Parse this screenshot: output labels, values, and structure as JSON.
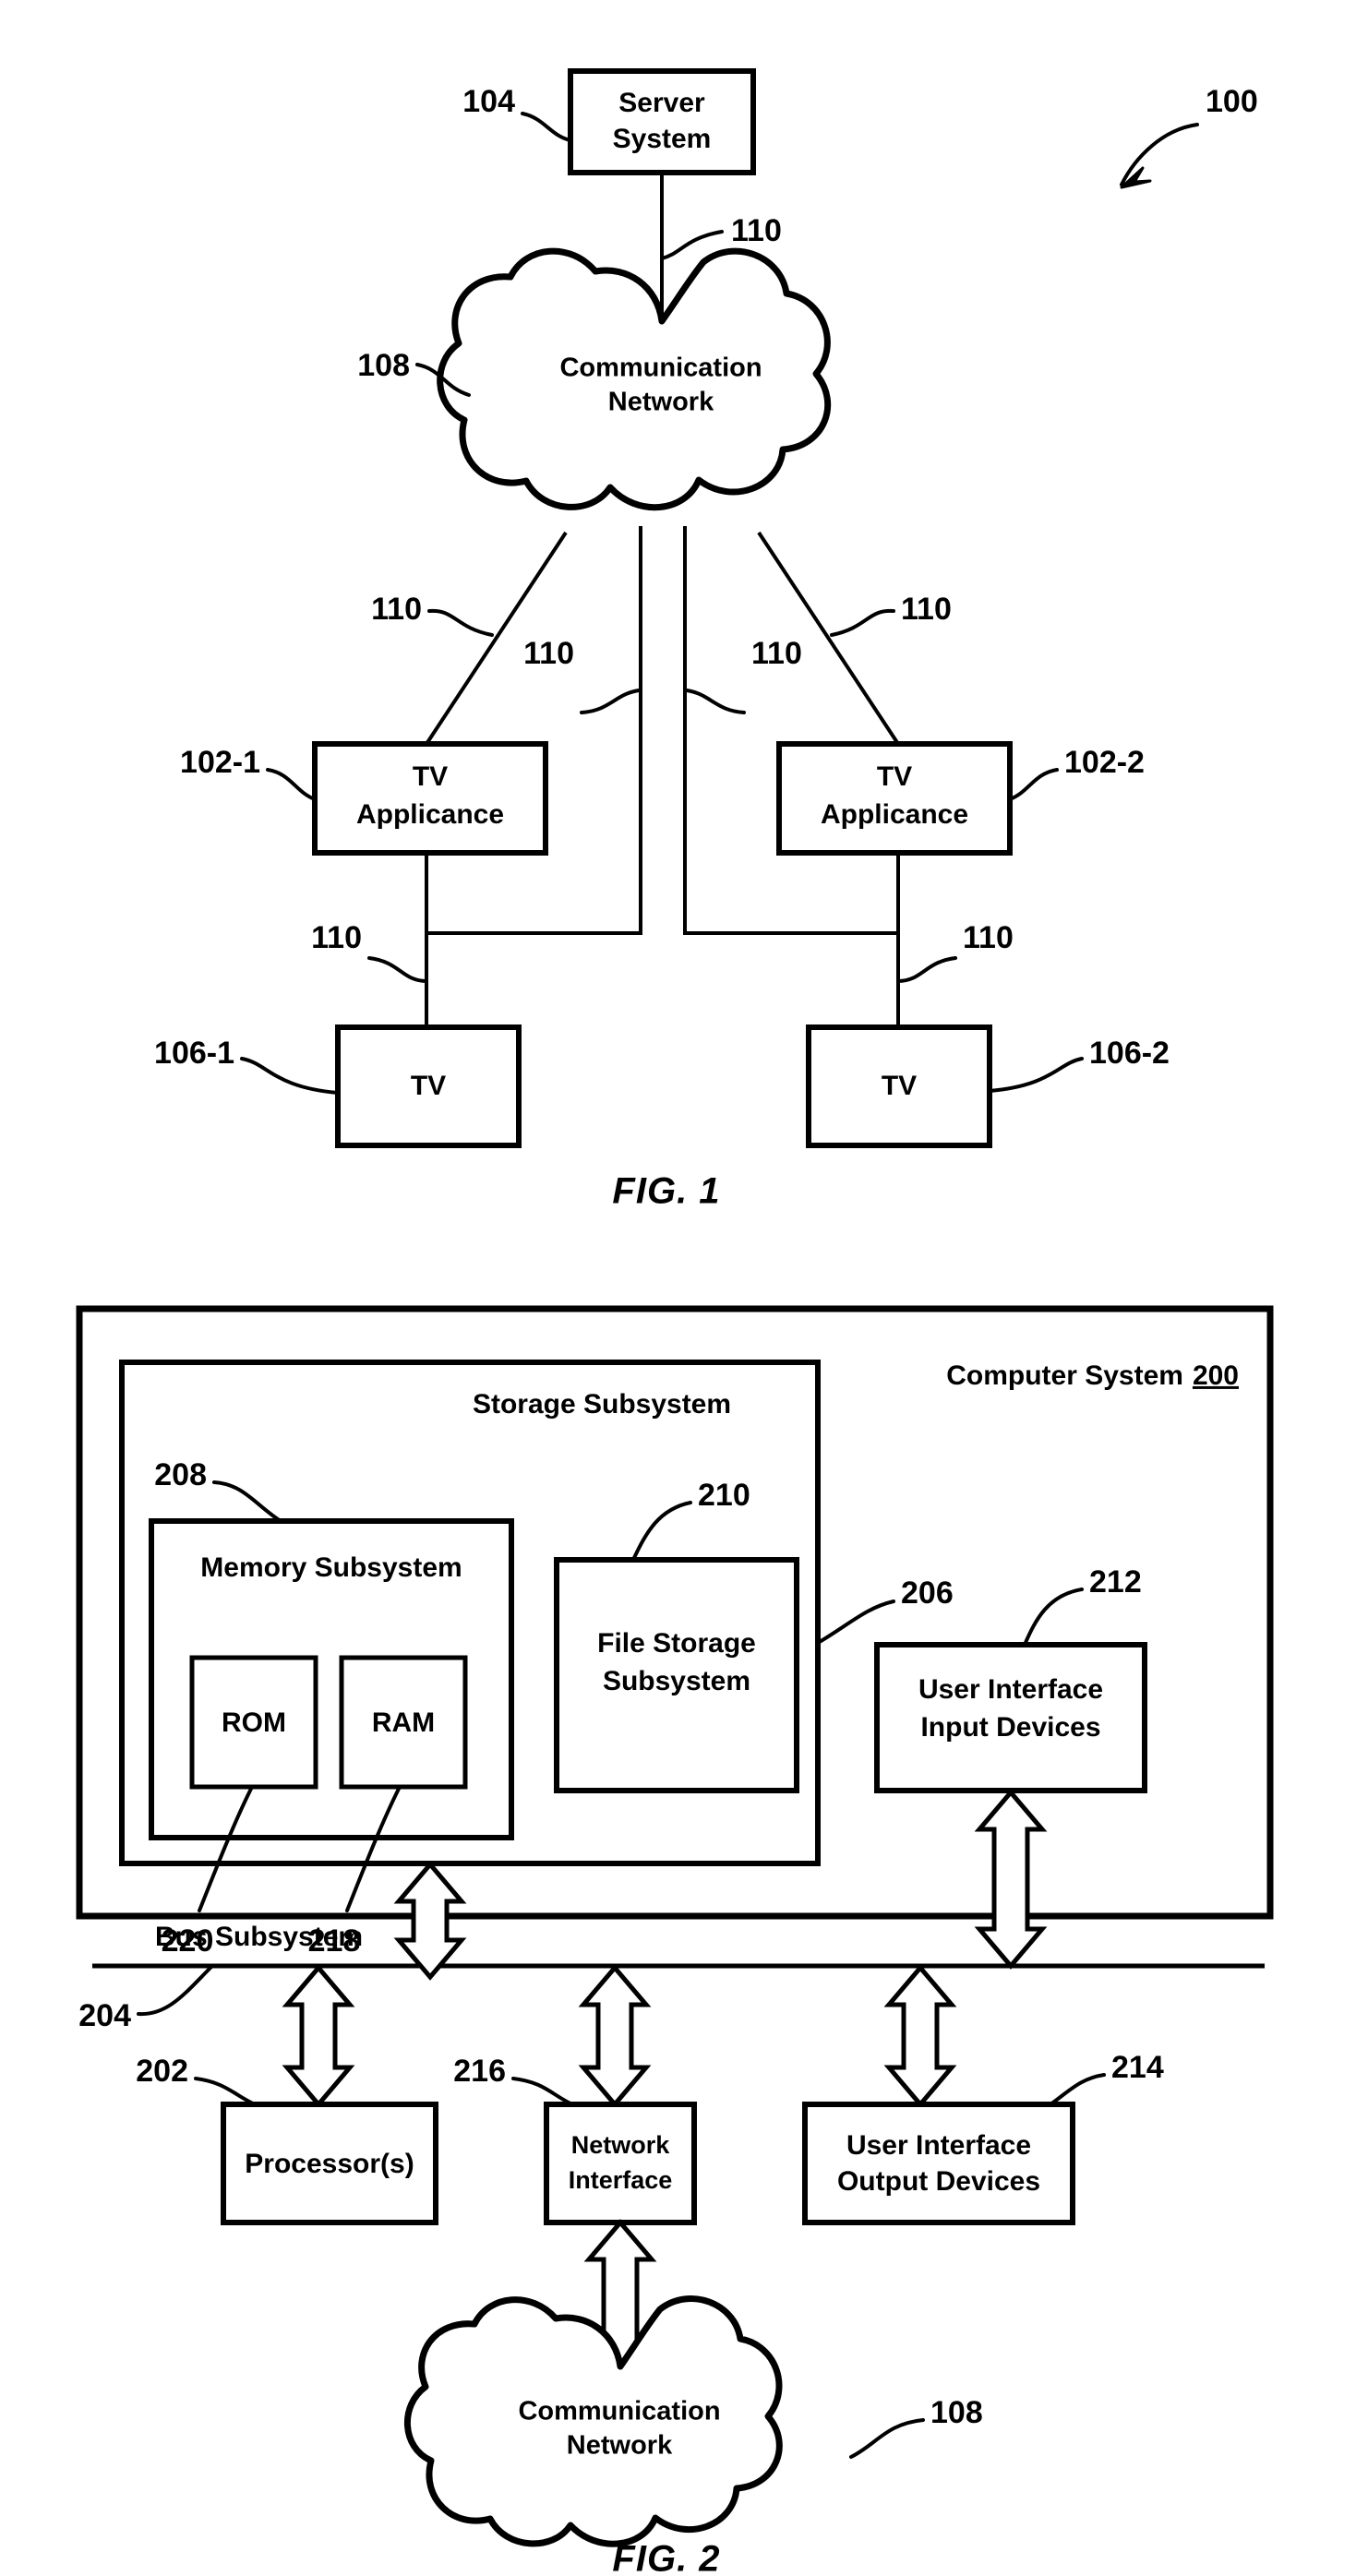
{
  "document": {
    "type": "patent-drawing-sheet",
    "figures": [
      "FIG. 1",
      "FIG. 2"
    ]
  },
  "figure1": {
    "caption": "FIG. 1",
    "system_ref": "100",
    "nodes": {
      "server": {
        "label_line1": "Server",
        "label_line2": "System",
        "ref": "104"
      },
      "cloud": {
        "label_line1": "Communication",
        "label_line2": "Network",
        "ref": "108"
      },
      "appliance_left": {
        "label_line1": "TV",
        "label_line2": "Applicance",
        "ref": "102-1"
      },
      "appliance_right": {
        "label_line1": "TV",
        "label_line2": "Applicance",
        "ref": "102-2"
      },
      "tv_left": {
        "label": "TV",
        "ref": "106-1"
      },
      "tv_right": {
        "label": "TV",
        "ref": "106-2"
      }
    },
    "link_refs": {
      "server_to_cloud": "110",
      "cloud_to_appliance_left": "110",
      "cloud_to_tv_left": "110",
      "cloud_to_tv_right": "110",
      "cloud_to_appliance_right": "110",
      "appliance_left_to_tv_left": "110",
      "appliance_right_to_tv_right": "110"
    }
  },
  "figure2": {
    "caption": "FIG. 2",
    "system": {
      "title": "Computer System",
      "ref": "200"
    },
    "storage_subsystem": {
      "title": "Storage Subsystem",
      "ref": "206"
    },
    "memory_subsystem": {
      "title": "Memory Subsystem",
      "ref": "208"
    },
    "rom": {
      "label": "ROM",
      "ref": "220"
    },
    "ram": {
      "label": "RAM",
      "ref": "218"
    },
    "file_storage": {
      "label_line1": "File Storage",
      "label_line2": "Subsystem",
      "ref": "210"
    },
    "ui_input": {
      "label_line1": "User Interface",
      "label_line2": "Input Devices",
      "ref": "212"
    },
    "bus": {
      "title": "Bus Subsystem",
      "ref": "204"
    },
    "processors": {
      "label": "Processor(s)",
      "ref": "202"
    },
    "network_interface": {
      "label_line1": "Network",
      "label_line2": "Interface",
      "ref": "216"
    },
    "ui_output": {
      "label_line1": "User Interface",
      "label_line2": "Output Devices",
      "ref": "214"
    },
    "cloud": {
      "label_line1": "Communication",
      "label_line2": "Network",
      "ref": "108"
    }
  },
  "colors": {
    "ink": "#000000",
    "paper": "#ffffff"
  }
}
